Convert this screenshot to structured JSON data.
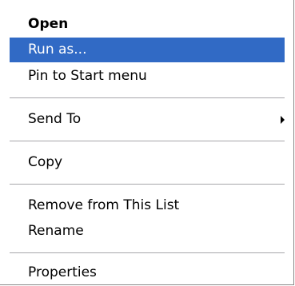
{
  "context_menu": {
    "selection_color": "#316ac5",
    "arrow_icon": "chevron-right-icon",
    "items": [
      {
        "label": "Open",
        "default": true
      },
      {
        "label": "Run as...",
        "selected": true
      },
      {
        "label": "Pin to Start menu"
      },
      {
        "label": "Send To",
        "submenu": true
      },
      {
        "label": "Copy"
      },
      {
        "label": "Remove from This List"
      },
      {
        "label": "Rename"
      },
      {
        "label": "Properties"
      }
    ]
  }
}
